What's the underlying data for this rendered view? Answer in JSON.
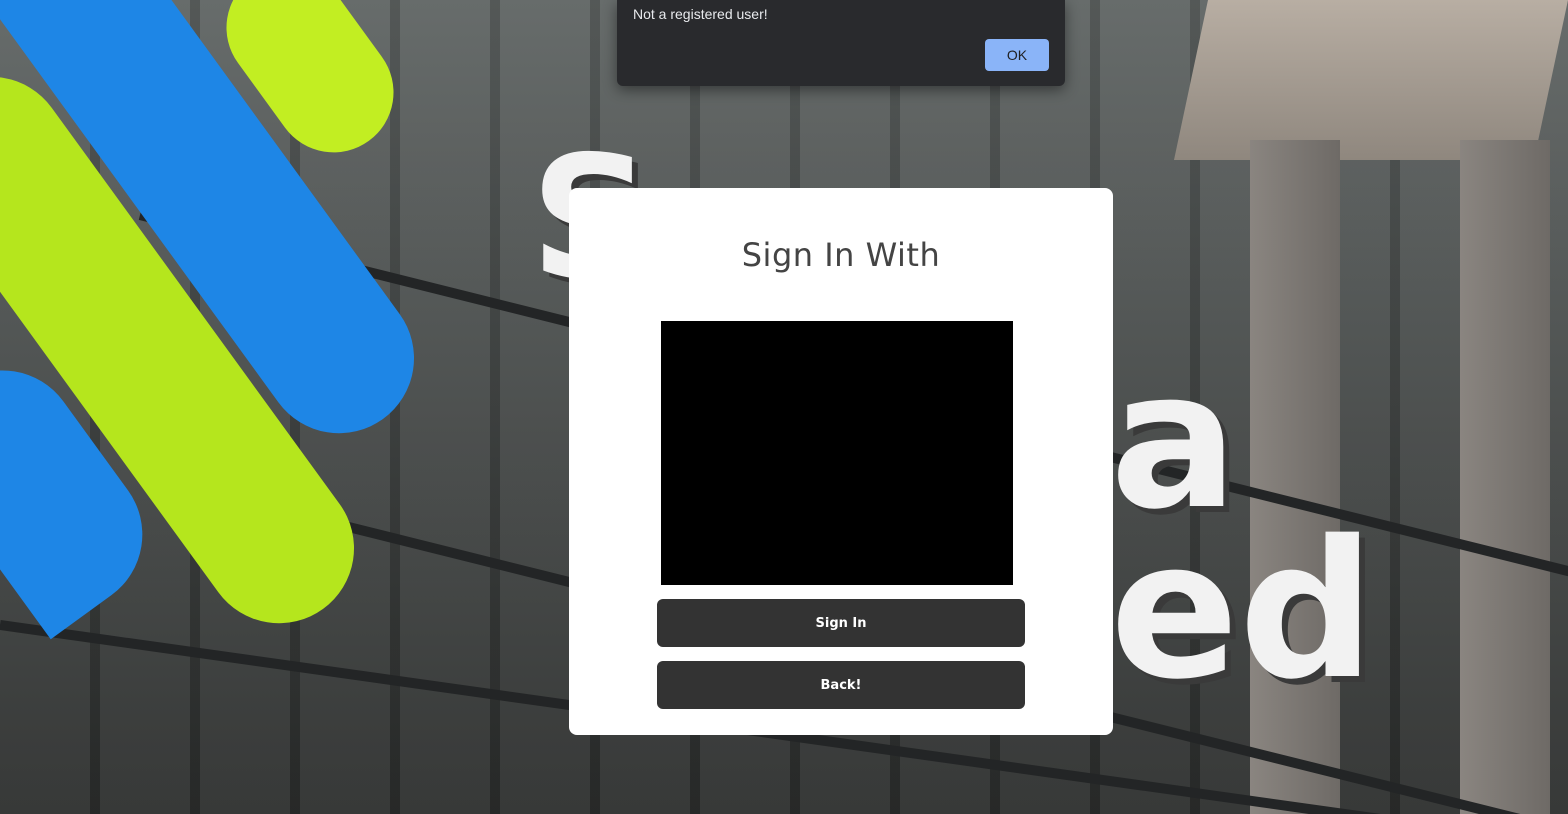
{
  "alert": {
    "message": "Not a registered user!",
    "ok_label": "OK"
  },
  "signin": {
    "title": "Sign In With",
    "camera_feed": "",
    "signin_label": "Sign In",
    "back_label": "Back!"
  },
  "colors": {
    "alert_background": "#292a2d",
    "alert_button": "#8ab4f8",
    "card_background": "#ffffff",
    "button_background": "#333333",
    "brand_blue": "#1e86e6",
    "brand_green": "#b5e61d"
  },
  "background": {
    "sign_letters": [
      "S",
      "a",
      "ed"
    ]
  }
}
